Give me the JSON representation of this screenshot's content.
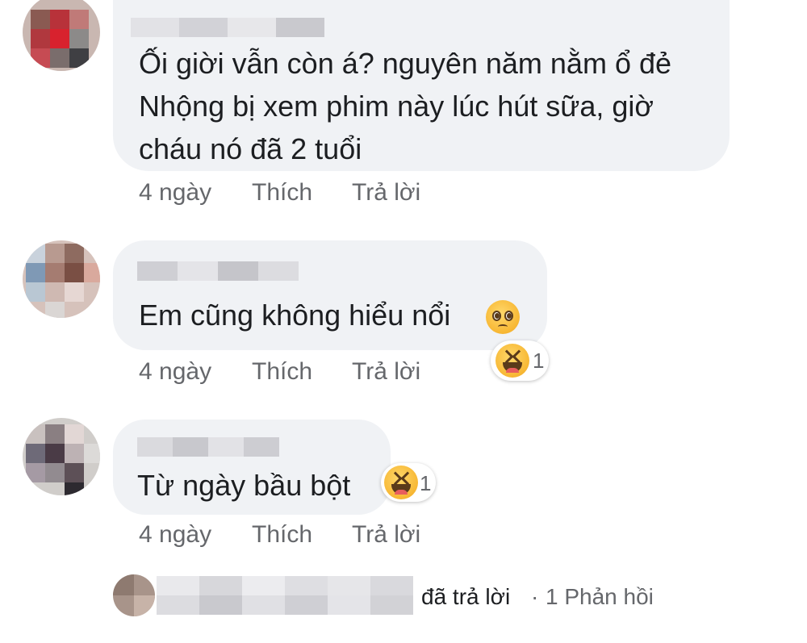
{
  "comments": [
    {
      "text_lines": [
        "Ối giời vẫn còn á? nguyên năm nằm ổ đẻ",
        "Nhộng bị xem phim này lúc hút sữa, giờ",
        "cháu nó đã 2 tuổi"
      ],
      "time": "4 ngày",
      "like": "Thích",
      "reply": "Trả lời"
    },
    {
      "text_lines": [
        "Em cũng không hiểu nổi"
      ],
      "time": "4 ngày",
      "like": "Thích",
      "reply": "Trả lời",
      "reaction": {
        "type": "haha",
        "count": "1"
      }
    },
    {
      "text_lines": [
        "Từ ngày bầu bột"
      ],
      "time": "4 ngày",
      "like": "Thích",
      "reply": "Trả lời",
      "reaction": {
        "type": "haha",
        "count": "1"
      }
    }
  ],
  "reply_summary": {
    "replied_label": "đã trả lời",
    "separator": "·",
    "count_label": "1 Phản hồi"
  },
  "icons": {
    "comment2_emoji": "pleading-face-icon",
    "reaction": "haha-icon"
  },
  "colors": {
    "bubble": "#f0f2f5",
    "meta_text": "#65676b",
    "body_text": "#1c1e21"
  }
}
